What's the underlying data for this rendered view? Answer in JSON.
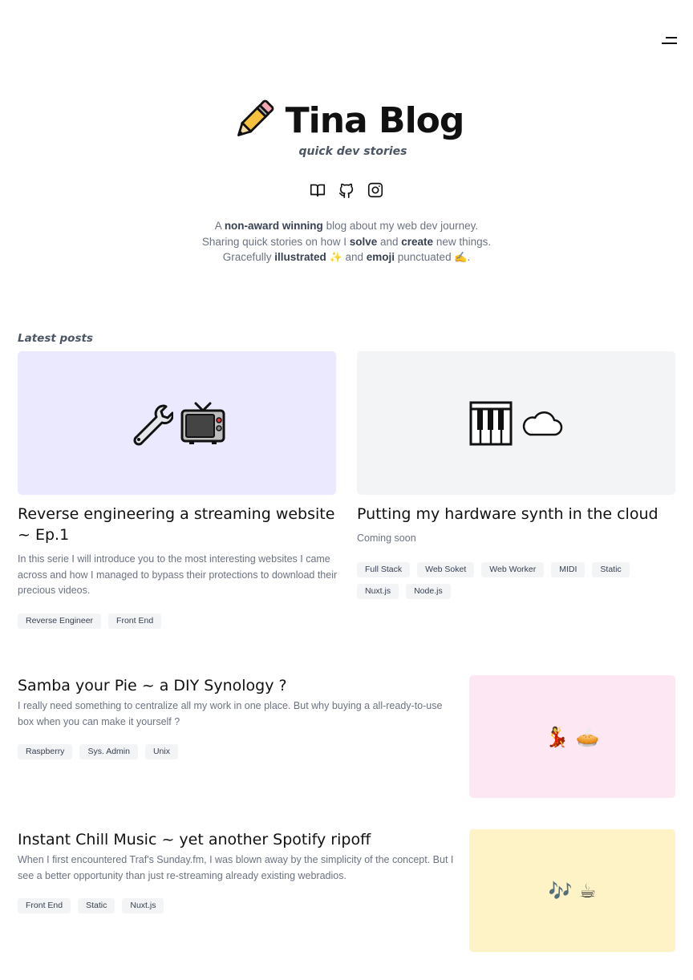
{
  "header": {
    "menu_icon": "menu-icon"
  },
  "hero": {
    "title": "Tina Blog",
    "tagline": "quick dev stories",
    "socials": [
      "book-icon",
      "github-icon",
      "instagram-icon"
    ],
    "intro": {
      "l1_a": "A ",
      "l1_b": "non-award winning",
      "l1_c": " blog about my web dev journey.",
      "l2_a": "Sharing quick stories on how I ",
      "l2_b": "solve",
      "l2_c": " and ",
      "l2_d": "create",
      "l2_e": " new things.",
      "l3_a": "Gracefully ",
      "l3_b": "illustrated",
      "l3_c": "✨",
      "l3_d": " and ",
      "l3_e": "emoji",
      "l3_f": " punctuated ",
      "l3_g": "✍️",
      "l3_h": "."
    }
  },
  "latest": {
    "label": "Latest posts",
    "posts": [
      {
        "title": "Reverse engineering a streaming website ~ Ep.1",
        "description": "In this serie I will introduce you to the most interesting websites I came across and how I managed to bypass their protections to download their precious videos.",
        "tags": [
          "Reverse Engineer",
          "Front End"
        ],
        "bg": "#ebe9fe",
        "icons": [
          "wrench-icon",
          "tv-icon"
        ]
      },
      {
        "title": "Putting my hardware synth in the cloud",
        "description": "Coming soon",
        "tags": [
          "Full Stack",
          "Web Soket",
          "Web Worker",
          "MIDI",
          "Static",
          "Nuxt.js",
          "Node.js"
        ],
        "bg": "#f3f4f6",
        "icons": [
          "piano-icon",
          "cloud-icon"
        ]
      },
      {
        "title": "Samba your Pie ~ a DIY Synology ?",
        "description": "I really need something to centralize all my work in one place. But why buying a all-ready-to-use box when you can make it yourself ?",
        "tags": [
          "Raspberry",
          "Sys. Admin",
          "Unix"
        ],
        "bg": "#fce7f3",
        "emojis": [
          "💃",
          "🥧"
        ]
      },
      {
        "title": "Instant Chill Music ~ yet another Spotify ripoff",
        "description": "When I first encountered Traf's Sunday.fm, I was blown away by the simplicity of the concept. But I see a better opportunity than just re-streaming already existing webradios.",
        "tags": [
          "Front End",
          "Static",
          "Nuxt.js"
        ],
        "bg": "#fef3c7",
        "emojis": [
          "🎶",
          "☕"
        ]
      }
    ]
  }
}
